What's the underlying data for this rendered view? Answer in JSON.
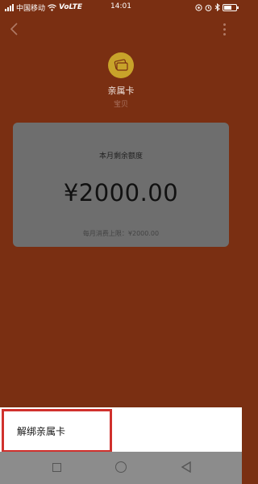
{
  "status_bar": {
    "carrier": "中国移动",
    "network": "VoLTE",
    "time": "14:01",
    "battery_level": 0.65
  },
  "nav": {
    "back_icon": "chevron-left-icon",
    "more_icon": "more-vertical-icon"
  },
  "header": {
    "logo_icon": "family-card-icon",
    "logo_color": "#c8a32a",
    "title": "亲属卡",
    "subtitle": "宝贝"
  },
  "quota": {
    "label": "本月剩余额度",
    "amount": "¥2000.00",
    "monthly_limit": "每月消费上限：¥2000.00"
  },
  "actions": {
    "unbind_label": "解绑亲属卡",
    "highlight_color": "#d0312d"
  },
  "system_nav": {
    "recent_icon": "square-icon",
    "home_icon": "circle-icon",
    "back_icon": "triangle-back-icon"
  }
}
